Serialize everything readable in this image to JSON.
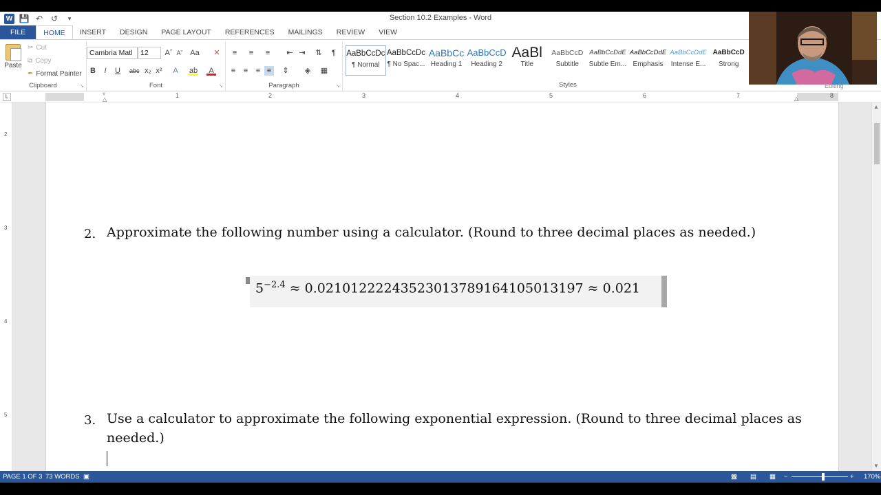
{
  "window": {
    "title": "Section 10.2 Examples - Word"
  },
  "quick_access": {
    "app_icon": "word-logo-icon",
    "items": [
      "save-icon",
      "undo-icon",
      "redo-icon",
      "customize-icon"
    ]
  },
  "tabs": [
    {
      "label": "FILE"
    },
    {
      "label": "HOME"
    },
    {
      "label": "INSERT"
    },
    {
      "label": "DESIGN"
    },
    {
      "label": "PAGE LAYOUT"
    },
    {
      "label": "REFERENCES"
    },
    {
      "label": "MAILINGS"
    },
    {
      "label": "REVIEW"
    },
    {
      "label": "VIEW"
    }
  ],
  "ribbon": {
    "clipboard": {
      "label": "Clipboard",
      "paste": "Paste",
      "cut": "Cut",
      "copy": "Copy",
      "format_painter": "Format Painter"
    },
    "font": {
      "label": "Font",
      "font_name": "Cambria Matl",
      "font_size": "12"
    },
    "paragraph": {
      "label": "Paragraph"
    },
    "styles": {
      "label": "Styles",
      "items": [
        {
          "preview": "AaBbCcDc",
          "name": "¶ Normal"
        },
        {
          "preview": "AaBbCcDc",
          "name": "¶ No Spac..."
        },
        {
          "preview": "AaBbCc",
          "name": "Heading 1"
        },
        {
          "preview": "AaBbCcD",
          "name": "Heading 2"
        },
        {
          "preview": "AaBl",
          "name": "Title"
        },
        {
          "preview": "AaBbCcD",
          "name": "Subtitle"
        },
        {
          "preview": "AaBbCcDdE",
          "name": "Subtle Em..."
        },
        {
          "preview": "AaBbCcDdE",
          "name": "Emphasis"
        },
        {
          "preview": "AaBbCcDdE",
          "name": "Intense E..."
        },
        {
          "preview": "AaBbCcD",
          "name": "Strong"
        }
      ]
    },
    "editing": {
      "label": "Editing"
    }
  },
  "ruler": {
    "numbers": [
      "1",
      "2",
      "3",
      "4",
      "5",
      "6",
      "7",
      "8"
    ]
  },
  "vruler": {
    "numbers": [
      "2",
      "3",
      "4",
      "5"
    ]
  },
  "document": {
    "q2": {
      "number": "2.",
      "text": "Approximate the following number using a calculator.  (Round to three decimal places as needed.)"
    },
    "math": {
      "base": "5",
      "exponent": "−2.4",
      "expression": " ≈ 0.021012222435230137891641050131​97 ≈ 0.021"
    },
    "q3": {
      "number": "3.",
      "line1": "Use a calculator to approximate the following exponential expression.  (Round to three decimal places as",
      "line2": "needed.)"
    }
  },
  "status": {
    "page": "PAGE 1 OF 3",
    "words": "73 WORDS",
    "zoom": "170%"
  },
  "colors": {
    "word_blue": "#2b579a"
  }
}
